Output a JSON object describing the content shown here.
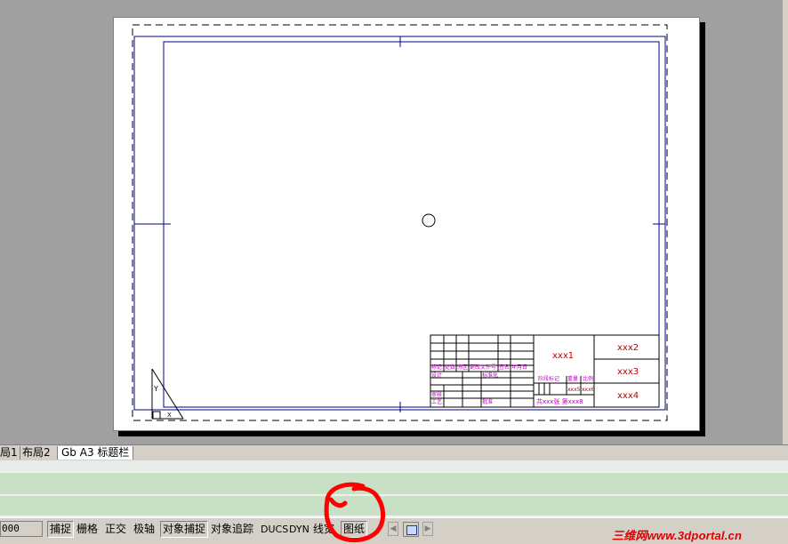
{
  "titleblock": {
    "field_labels": [
      "标记",
      "处数",
      "分区",
      "更改文件号",
      "签名",
      "年月日",
      "设计",
      "标准化",
      "阶段标记",
      "重量",
      "比例",
      "审核",
      "工艺",
      "批准"
    ],
    "cell_xxx1": "xxx1",
    "cell_xxx2": "xxx2",
    "cell_xxx3": "xxx3",
    "cell_xxx4": "xxx4",
    "cell_xxx5": "xxx5",
    "cell_scale": "xxx6",
    "sheet_text": "共xxx张 第xxx8"
  },
  "ucs": {
    "y_label": "Y",
    "x_label": "X"
  },
  "tabs": {
    "layout1": "局1",
    "layout2": "布局2",
    "layout3": "Gb A3 标题栏"
  },
  "status": {
    "coordinates": "000",
    "snap": "捕捉",
    "grid": "栅格",
    "ortho": "正交",
    "polar": "极轴",
    "osnap": "对象捕捉",
    "otrack": "对象追踪",
    "ducs": "DUCS",
    "dyn": "DYN",
    "lwt": "线宽",
    "paper": "图纸"
  },
  "watermark": "三维网www.3dportal.cn",
  "colors": {
    "border_blue": "#00008b",
    "magenta_text": "#c000c0",
    "red_text": "#c00000",
    "annotation_red": "#ff0000",
    "cmd_green": "#c8e0c4"
  },
  "icons": {
    "prev_arrow": "triangle-left-icon",
    "next_arrow": "triangle-right-icon",
    "model_toggle": "model-space-icon"
  }
}
